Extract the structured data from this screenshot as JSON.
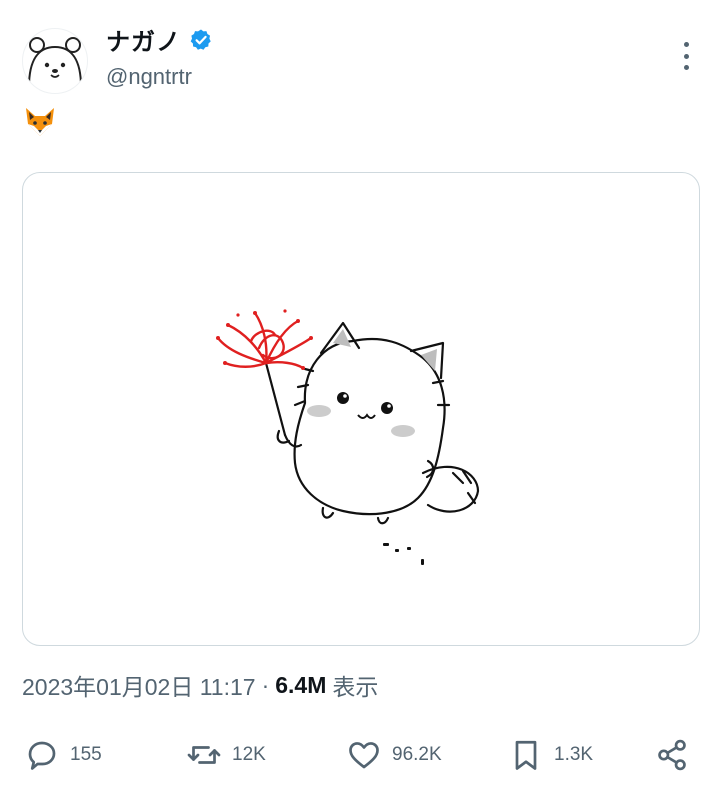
{
  "author": {
    "display_name": "ナガノ",
    "handle": "@ngntrtr",
    "verified": true,
    "avatar_icon": "white-bear-avatar"
  },
  "tweet": {
    "text": "🦊",
    "media_icon": "fox-holding-red-spider-lily-illustration"
  },
  "meta": {
    "timestamp": "2023年01月02日 11:17",
    "separator": "·",
    "views_count": "6.4M",
    "views_label": "表示"
  },
  "actions": {
    "replies": "155",
    "retweets": "12K",
    "likes": "96.2K",
    "bookmarks": "1.3K"
  },
  "colors": {
    "text_primary": "#0f1419",
    "text_secondary": "#536471",
    "verified_blue": "#1d9bf0",
    "border": "#cfd9de",
    "flower_red": "#e02020"
  }
}
